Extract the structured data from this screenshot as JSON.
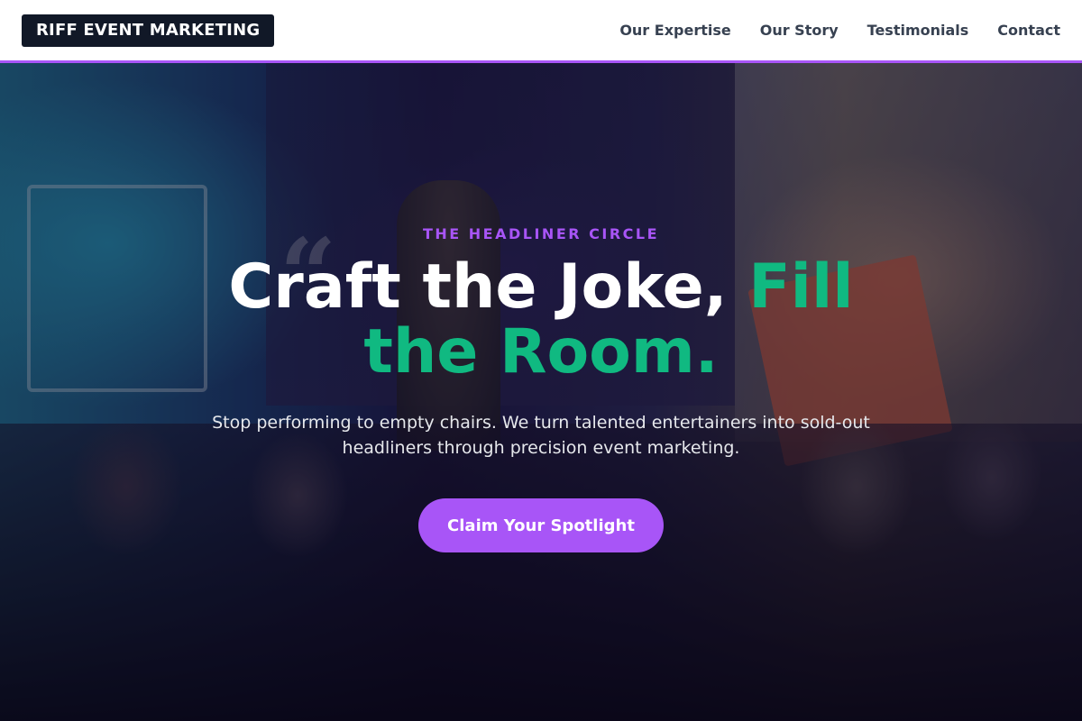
{
  "header": {
    "logo": "RIFF EVENT MARKETING",
    "nav": [
      {
        "label": "Our Expertise"
      },
      {
        "label": "Our Story"
      },
      {
        "label": "Testimonials"
      },
      {
        "label": "Contact"
      }
    ]
  },
  "hero": {
    "eyebrow": "THE HEADLINER CIRCLE",
    "headline_main": "Craft the Joke, ",
    "headline_accent": "Fill the Room.",
    "subtext": "Stop performing to empty chairs. We turn talented entertainers into sold-out headliners through precision event marketing.",
    "cta_label": "Claim Your Spotlight"
  },
  "colors": {
    "accent_purple": "#a855f7",
    "accent_green": "#10b981",
    "logo_bg": "#111827"
  }
}
